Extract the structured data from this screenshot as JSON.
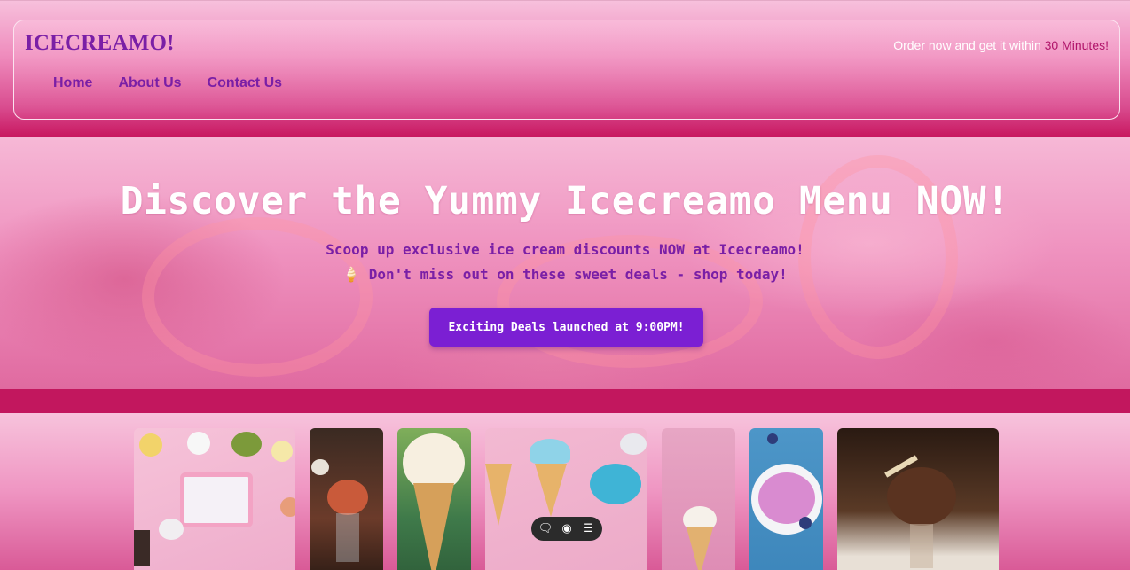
{
  "header": {
    "brand": "ICECREAMO!",
    "tagline_prefix": "Order now and get it within ",
    "tagline_accent": "30 Minutes!",
    "nav": [
      "Home",
      "About Us",
      "Contact Us"
    ]
  },
  "hero": {
    "title": "Discover the Yummy Icecreamo Menu NOW!",
    "subtitle_line1": "Scoop up exclusive ice cream discounts NOW at Icecreamo!",
    "subtitle_emoji": "🍦",
    "subtitle_line2": " Don't miss out on these sweet deals - shop today!",
    "button_label": "Exciting Deals launched at 9:00PM!"
  },
  "gallery": {
    "images": [
      "ice-cream-flatlay-image",
      "sundae-glass-image",
      "sprinkle-cone-image",
      "cones-macarons-image",
      "cone-sprinkles-image",
      "berry-bowl-image",
      "chocolate-sundae-image"
    ]
  },
  "toolbar": {
    "icons": [
      "comment-icon",
      "view-icon",
      "menu-icon"
    ],
    "glyphs": [
      "🗨",
      "◉",
      "☰"
    ]
  },
  "colors": {
    "brand": "#7a1fa6",
    "accent": "#b0146a",
    "button": "#7b1fd3",
    "band": "#c2175e"
  }
}
